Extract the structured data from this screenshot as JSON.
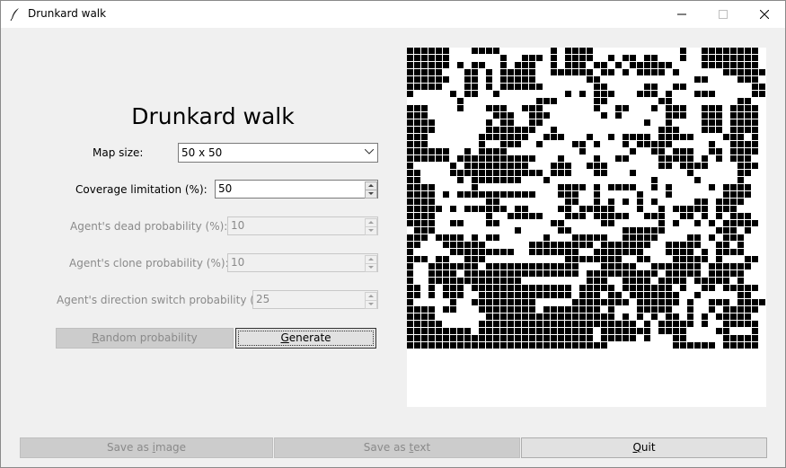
{
  "window": {
    "title": "Drunkard walk"
  },
  "header": {
    "title": "Drunkard walk"
  },
  "form": {
    "map_size": {
      "label": "Map size:",
      "value": "50 x 50"
    },
    "coverage": {
      "label": "Coverage limitation (%):",
      "value": "50"
    },
    "dead_prob": {
      "label": "Agent's dead probability (%):",
      "value": "10"
    },
    "clone_prob": {
      "label": "Agent's clone probability (%):",
      "value": "10"
    },
    "switch_prob": {
      "label": "Agent's direction switch probability (%):",
      "value": "25"
    }
  },
  "buttons": {
    "random": {
      "mnemonic": "R",
      "rest": "andom probability"
    },
    "generate": {
      "mnemonic": "G",
      "rest": "enerate"
    },
    "save_image": {
      "pre": "Save as ",
      "mnemonic": "i",
      "rest": "mage"
    },
    "save_text": {
      "pre": "Save as ",
      "mnemonic": "t",
      "rest": "ext"
    },
    "quit": {
      "mnemonic": "Q",
      "rest": "uit"
    }
  },
  "map": {
    "size": 50,
    "colors": {
      "wall": "#000000",
      "floor": "#ffffff",
      "gridline": "#ffffff"
    },
    "rows": [
      "######...####.......#.####............#..########",
      "######.......#..###.#.####..#.##.##...#..########",
      "######.#.##..#.###..#.###.##.#.######....########",
      "#####...##.#.#####..######.##.#.####.#......######",
      "######..##.#.#####.......##.............##....###",
      "#####...##.#.######.......##.....##..##.........##",
      "#.....#.##..#.........#.#.###...###.#...###.....##",
      ".......#..........###.....##.......##.........##..",
      "###....#...###..###.......#..##...#.###..###.####",
      "###.........###..###.......#.#......###..###.####",
      "####.......#.##..##..............#..#....###.####",
      "####.......#######..#..............###...###.####",
      "###.......#######..###...#..#.####.#####....###.#",
      "###.......#..###..#....##.#...#.#####.....#..####",
      "######..#.####..........#......#..##.###..##.####",
      "######.###########...#....#..##....#####.#.#.###",
      "#.....#.#########...###..###.......##.####....###",
      "##....#############.###...##...#.......#......##",
      "##.....#.#######...#..............#.....#.....#.",
      "####.....#...........####.#.####..#.#.....#.####",
      "####.#.###########...###..#.....#...#.......####",
      "####.......##.........##..#.#.#.#.#.....##.####",
      "#####.#.######.##....##.#####...#..#.#####.###",
      "####.......#..#####...###.#####..###..##.#.#.###",
      "####..##...##.......##.....##......#.#..#.#.#####",
      ".###...........#.....##.......######.......###.#",
      "###.####.#.##......#...#####..#####....##.#.###",
      "##...######......#########.#######..#####..##.#",
      "#.....#########..#######..#######...####.#.####",
      "###.##..###...........########..##...#####.#...##",
      "#..#######.#############...#####..#######.######",
      "#..####.################.##########.#####.#####.",
      "#..#############.........###..####.####.#####.#.",
      "##.#.###.##############.#####.#######.#..##.#####",
      "##.#.###..#############.###.##.#######..#.....##.",
      "#.....#..#########.....########.######.#..###.####",
      "####.##...########.########.#...#####..#..#.#####",
      "####.......##################.#.#.#.##.#.#.#####.",
      "#####.....######################.#.#####.#..#####",
      "#########.################.#######.####....##...#.",
      "##########################.#####.#...##.....#####",
      "############################.........######.#####"
    ]
  }
}
